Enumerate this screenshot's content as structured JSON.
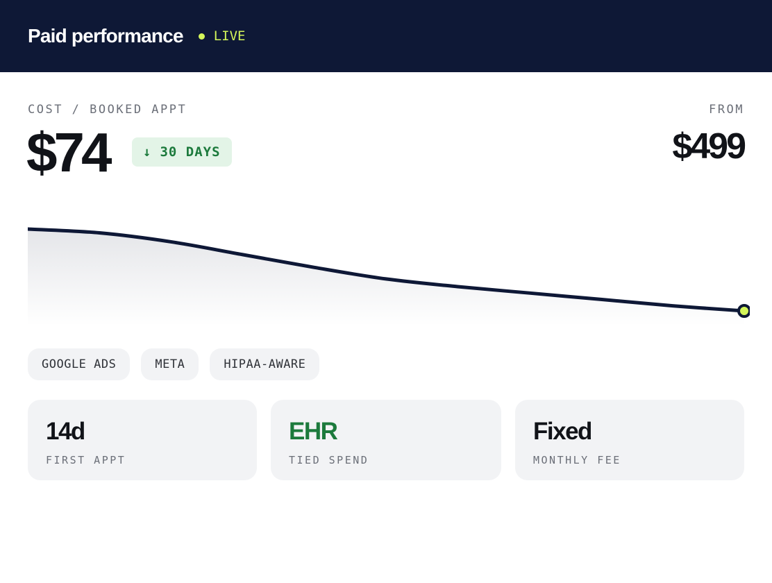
{
  "header": {
    "title": "Paid performance",
    "status": "LIVE",
    "status_color": "#d4f65a",
    "background": "#0e1836"
  },
  "metric": {
    "label": "COST / BOOKED APPT",
    "value": "$74",
    "delta": "30 DAYS",
    "delta_icon": "arrow-down-icon",
    "delta_color": "#1c7a3c"
  },
  "pricing": {
    "label": "FROM",
    "value": "$499"
  },
  "trend": {
    "values": [
      100,
      97,
      90,
      80,
      70,
      61,
      55,
      50,
      45,
      40,
      36
    ]
  },
  "tags": [
    "GOOGLE ADS",
    "META",
    "HIPAA-AWARE"
  ],
  "cards": [
    {
      "value": "14d",
      "label": "FIRST APPT"
    },
    {
      "value": "EHR",
      "label": "TIED SPEND"
    },
    {
      "value": "Fixed",
      "label": "MONTHLY FEE"
    }
  ]
}
